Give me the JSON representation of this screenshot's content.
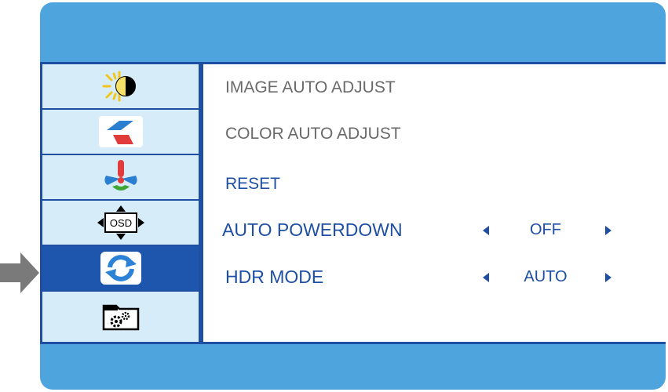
{
  "sidebar": {
    "items": [
      {
        "icon": "brightness-contrast-icon"
      },
      {
        "icon": "image-setup-icon"
      },
      {
        "icon": "color-setup-icon"
      },
      {
        "icon": "osd-setup-icon",
        "label": "OSD"
      },
      {
        "icon": "extra-reset-icon",
        "active": true
      },
      {
        "icon": "misc-settings-icon"
      }
    ]
  },
  "menu": {
    "image_auto_adjust": "IMAGE AUTO ADJUST",
    "color_auto_adjust": "COLOR AUTO ADJUST",
    "reset": "RESET",
    "auto_powerdown": {
      "label": "AUTO POWERDOWN",
      "value": "OFF"
    },
    "hdr_mode": {
      "label": "HDR MODE",
      "value": "AUTO"
    }
  },
  "colors": {
    "frame": "#4ea4dc",
    "sidebar_bg": "#d6ecf8",
    "active": "#1f56ad",
    "text": "#1e4fa3",
    "dim_text": "#6a6a6a"
  }
}
